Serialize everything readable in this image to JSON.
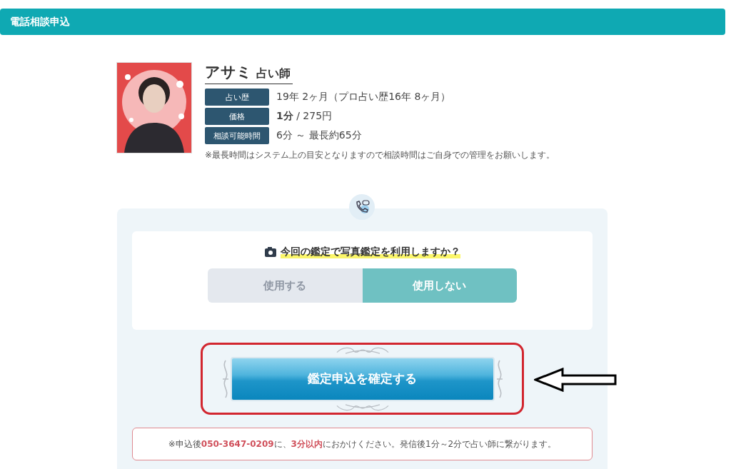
{
  "header": {
    "title": "電話相談申込"
  },
  "profile": {
    "name": "アサミ",
    "role": "占い師",
    "details": [
      {
        "label": "占い歴",
        "value": "19年 2ヶ月（プロ占い歴16年 8ヶ月）"
      },
      {
        "label": "価格",
        "value": "**1分** / 275円"
      },
      {
        "label": "相談可能時間",
        "value": "6分 ～ 最長約65分"
      }
    ],
    "note": "※最長時間はシステム上の目安となりますので相談時間はご自身での管理をお願いします。"
  },
  "photo_option": {
    "question": "今回の鑑定で写真鑑定を利用しますか？",
    "options": [
      {
        "label": "使用する",
        "selected": false
      },
      {
        "label": "使用しない",
        "selected": true
      }
    ]
  },
  "confirm_button": {
    "label": "鑑定申込を確定する",
    "highlighted": true
  },
  "notice": "※申込後**050-3647-0209**に、**3分以内**におかけください。発信後1分～2分で占い師に繋がります。"
}
